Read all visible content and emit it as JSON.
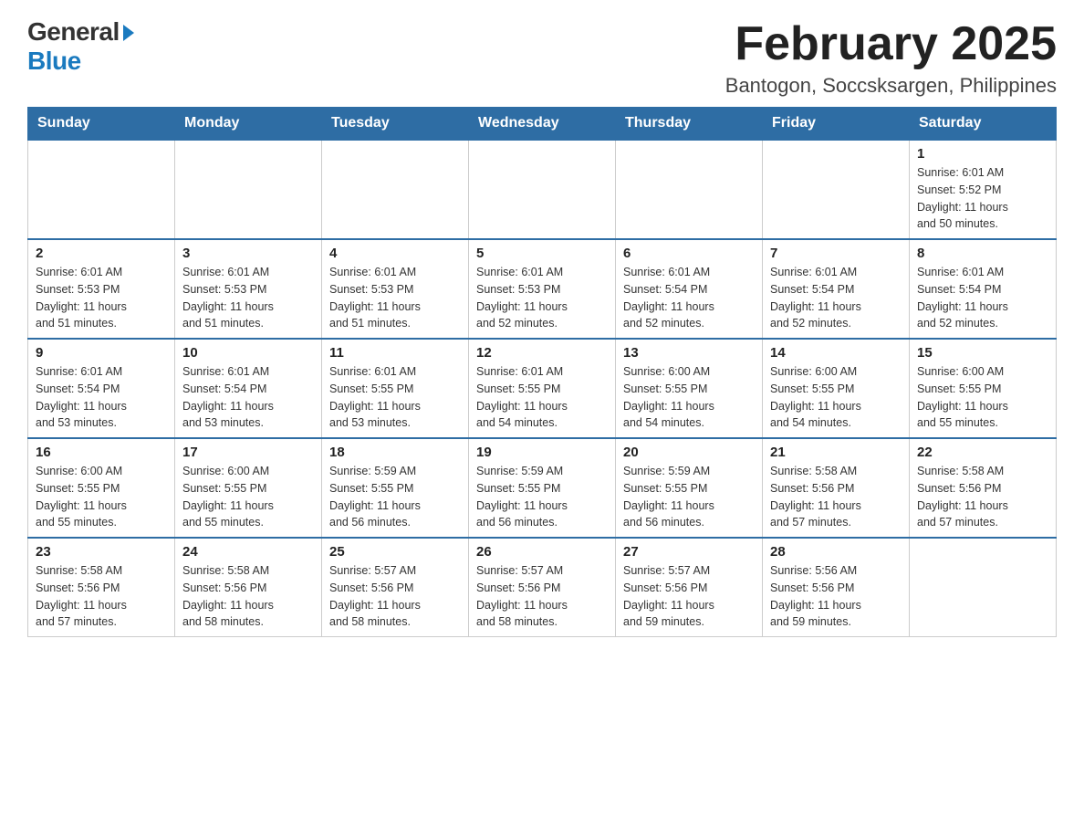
{
  "header": {
    "logo_general": "General",
    "logo_blue": "Blue",
    "calendar_title": "February 2025",
    "calendar_subtitle": "Bantogon, Soccsksargen, Philippines"
  },
  "days_of_week": [
    "Sunday",
    "Monday",
    "Tuesday",
    "Wednesday",
    "Thursday",
    "Friday",
    "Saturday"
  ],
  "weeks": [
    {
      "days": [
        {
          "number": "",
          "info": ""
        },
        {
          "number": "",
          "info": ""
        },
        {
          "number": "",
          "info": ""
        },
        {
          "number": "",
          "info": ""
        },
        {
          "number": "",
          "info": ""
        },
        {
          "number": "",
          "info": ""
        },
        {
          "number": "1",
          "info": "Sunrise: 6:01 AM\nSunset: 5:52 PM\nDaylight: 11 hours\nand 50 minutes."
        }
      ]
    },
    {
      "days": [
        {
          "number": "2",
          "info": "Sunrise: 6:01 AM\nSunset: 5:53 PM\nDaylight: 11 hours\nand 51 minutes."
        },
        {
          "number": "3",
          "info": "Sunrise: 6:01 AM\nSunset: 5:53 PM\nDaylight: 11 hours\nand 51 minutes."
        },
        {
          "number": "4",
          "info": "Sunrise: 6:01 AM\nSunset: 5:53 PM\nDaylight: 11 hours\nand 51 minutes."
        },
        {
          "number": "5",
          "info": "Sunrise: 6:01 AM\nSunset: 5:53 PM\nDaylight: 11 hours\nand 52 minutes."
        },
        {
          "number": "6",
          "info": "Sunrise: 6:01 AM\nSunset: 5:54 PM\nDaylight: 11 hours\nand 52 minutes."
        },
        {
          "number": "7",
          "info": "Sunrise: 6:01 AM\nSunset: 5:54 PM\nDaylight: 11 hours\nand 52 minutes."
        },
        {
          "number": "8",
          "info": "Sunrise: 6:01 AM\nSunset: 5:54 PM\nDaylight: 11 hours\nand 52 minutes."
        }
      ]
    },
    {
      "days": [
        {
          "number": "9",
          "info": "Sunrise: 6:01 AM\nSunset: 5:54 PM\nDaylight: 11 hours\nand 53 minutes."
        },
        {
          "number": "10",
          "info": "Sunrise: 6:01 AM\nSunset: 5:54 PM\nDaylight: 11 hours\nand 53 minutes."
        },
        {
          "number": "11",
          "info": "Sunrise: 6:01 AM\nSunset: 5:55 PM\nDaylight: 11 hours\nand 53 minutes."
        },
        {
          "number": "12",
          "info": "Sunrise: 6:01 AM\nSunset: 5:55 PM\nDaylight: 11 hours\nand 54 minutes."
        },
        {
          "number": "13",
          "info": "Sunrise: 6:00 AM\nSunset: 5:55 PM\nDaylight: 11 hours\nand 54 minutes."
        },
        {
          "number": "14",
          "info": "Sunrise: 6:00 AM\nSunset: 5:55 PM\nDaylight: 11 hours\nand 54 minutes."
        },
        {
          "number": "15",
          "info": "Sunrise: 6:00 AM\nSunset: 5:55 PM\nDaylight: 11 hours\nand 55 minutes."
        }
      ]
    },
    {
      "days": [
        {
          "number": "16",
          "info": "Sunrise: 6:00 AM\nSunset: 5:55 PM\nDaylight: 11 hours\nand 55 minutes."
        },
        {
          "number": "17",
          "info": "Sunrise: 6:00 AM\nSunset: 5:55 PM\nDaylight: 11 hours\nand 55 minutes."
        },
        {
          "number": "18",
          "info": "Sunrise: 5:59 AM\nSunset: 5:55 PM\nDaylight: 11 hours\nand 56 minutes."
        },
        {
          "number": "19",
          "info": "Sunrise: 5:59 AM\nSunset: 5:55 PM\nDaylight: 11 hours\nand 56 minutes."
        },
        {
          "number": "20",
          "info": "Sunrise: 5:59 AM\nSunset: 5:55 PM\nDaylight: 11 hours\nand 56 minutes."
        },
        {
          "number": "21",
          "info": "Sunrise: 5:58 AM\nSunset: 5:56 PM\nDaylight: 11 hours\nand 57 minutes."
        },
        {
          "number": "22",
          "info": "Sunrise: 5:58 AM\nSunset: 5:56 PM\nDaylight: 11 hours\nand 57 minutes."
        }
      ]
    },
    {
      "days": [
        {
          "number": "23",
          "info": "Sunrise: 5:58 AM\nSunset: 5:56 PM\nDaylight: 11 hours\nand 57 minutes."
        },
        {
          "number": "24",
          "info": "Sunrise: 5:58 AM\nSunset: 5:56 PM\nDaylight: 11 hours\nand 58 minutes."
        },
        {
          "number": "25",
          "info": "Sunrise: 5:57 AM\nSunset: 5:56 PM\nDaylight: 11 hours\nand 58 minutes."
        },
        {
          "number": "26",
          "info": "Sunrise: 5:57 AM\nSunset: 5:56 PM\nDaylight: 11 hours\nand 58 minutes."
        },
        {
          "number": "27",
          "info": "Sunrise: 5:57 AM\nSunset: 5:56 PM\nDaylight: 11 hours\nand 59 minutes."
        },
        {
          "number": "28",
          "info": "Sunrise: 5:56 AM\nSunset: 5:56 PM\nDaylight: 11 hours\nand 59 minutes."
        },
        {
          "number": "",
          "info": ""
        }
      ]
    }
  ]
}
